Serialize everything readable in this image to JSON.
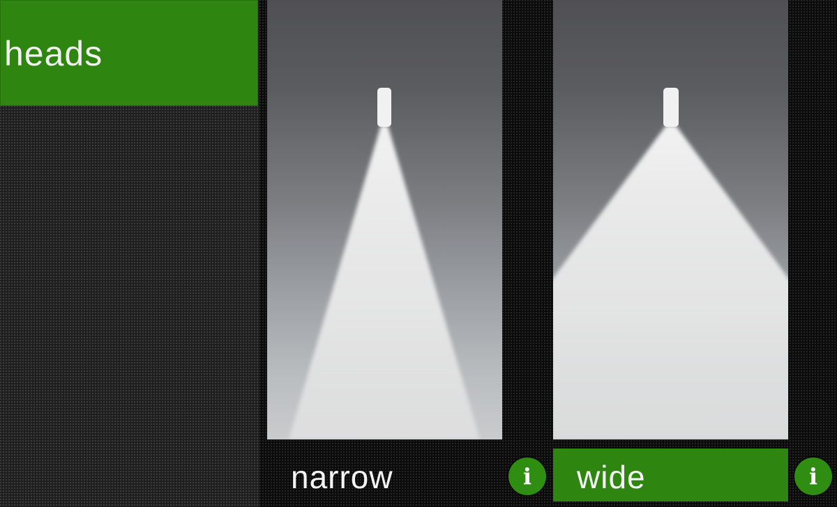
{
  "header": {
    "heads_label": "heads"
  },
  "options": [
    {
      "label": "narrow",
      "selected": false,
      "info_icon": "i"
    },
    {
      "label": "wide",
      "selected": true,
      "info_icon": "i"
    }
  ],
  "colors": {
    "accent_green": "#2e8610",
    "panel_top": "#505054",
    "panel_bottom": "#c9cbcd",
    "spray": "#f2f2f2"
  },
  "icons": [
    "info-icon",
    "spray-nozzle-icon"
  ]
}
